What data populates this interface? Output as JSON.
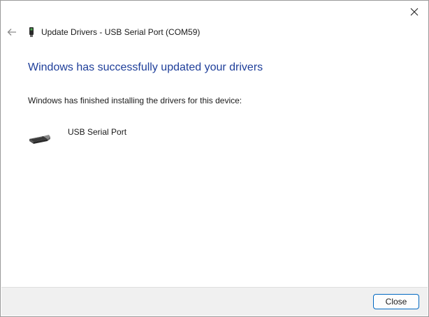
{
  "window": {
    "title": "Update Drivers - USB Serial Port (COM59)"
  },
  "content": {
    "heading": "Windows has successfully updated your drivers",
    "message": "Windows has finished installing the drivers for this device:",
    "device_name": "USB Serial Port"
  },
  "footer": {
    "close_label": "Close"
  },
  "icons": {
    "back": "back-arrow-icon",
    "close": "close-icon",
    "device_small": "usb-device-icon",
    "device_large": "serial-port-connector-icon"
  },
  "colors": {
    "heading": "#1f3f9a",
    "button_border": "#0067c0",
    "footer_bg": "#f0f0f0"
  }
}
